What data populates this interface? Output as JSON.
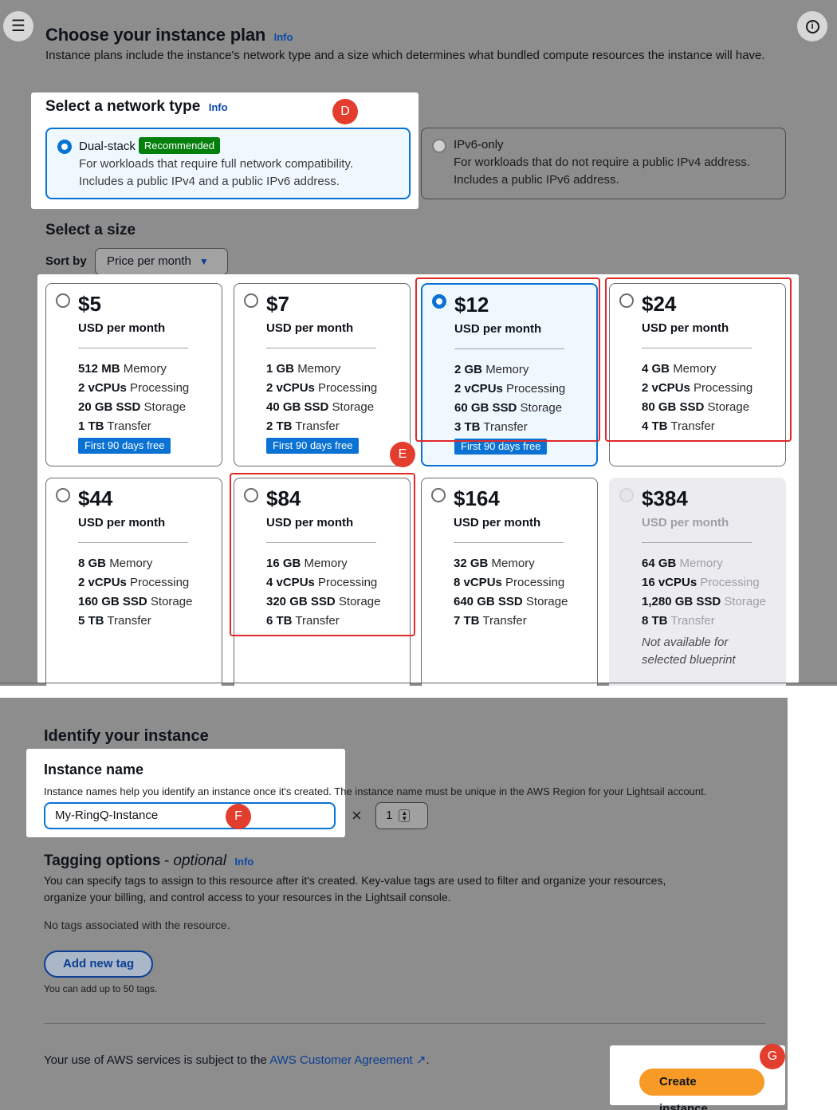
{
  "plan": {
    "title": "Choose your instance plan",
    "info": "Info",
    "description": "Instance plans include the instance's network type and a size which determines what bundled compute resources the instance will have."
  },
  "network": {
    "title": "Select a network type",
    "info": "Info",
    "options": [
      {
        "title": "Dual-stack",
        "badge": "Recommended",
        "line1": "For workloads that require full network compatibility.",
        "line2": "Includes a public IPv4 and a public IPv6 address.",
        "selected": true
      },
      {
        "title": "IPv6-only",
        "line1": "For workloads that do not require a public IPv4 address.",
        "line2": "Includes a public IPv6 address.",
        "selected": false
      }
    ]
  },
  "size": {
    "title": "Select a size",
    "sort_label": "Sort by",
    "sort_value": "Price per month",
    "per_month": "USD per month",
    "spec_labels": {
      "memory": "Memory",
      "processing": "Processing",
      "storage": "Storage",
      "transfer": "Transfer"
    },
    "free_badge": "First 90 days free",
    "not_available": [
      "Not available for",
      "selected blueprint"
    ],
    "plans": [
      {
        "price": "$5",
        "memory": "512 MB",
        "cpu": "2 vCPUs",
        "storage": "20 GB SSD",
        "transfer": "1 TB",
        "free": true,
        "selected": false
      },
      {
        "price": "$7",
        "memory": "1 GB",
        "cpu": "2 vCPUs",
        "storage": "40 GB SSD",
        "transfer": "2 TB",
        "free": true,
        "selected": false
      },
      {
        "price": "$12",
        "memory": "2 GB",
        "cpu": "2 vCPUs",
        "storage": "60 GB SSD",
        "transfer": "3 TB",
        "free": true,
        "selected": true
      },
      {
        "price": "$24",
        "memory": "4 GB",
        "cpu": "2 vCPUs",
        "storage": "80 GB SSD",
        "transfer": "4 TB",
        "free": false,
        "selected": false
      },
      {
        "price": "$44",
        "memory": "8 GB",
        "cpu": "2 vCPUs",
        "storage": "160 GB SSD",
        "transfer": "5 TB",
        "free": false,
        "selected": false
      },
      {
        "price": "$84",
        "memory": "16 GB",
        "cpu": "4 vCPUs",
        "storage": "320 GB SSD",
        "transfer": "6 TB",
        "free": false,
        "selected": false
      },
      {
        "price": "$164",
        "memory": "32 GB",
        "cpu": "8 vCPUs",
        "storage": "640 GB SSD",
        "transfer": "7 TB",
        "free": false,
        "selected": false
      },
      {
        "price": "$384",
        "memory": "64 GB",
        "cpu": "16 vCPUs",
        "storage": "1,280 GB SSD",
        "transfer": "8 TB",
        "free": false,
        "selected": false,
        "disabled": true
      }
    ]
  },
  "identify": {
    "title": "Identify your instance",
    "name_label": "Instance name",
    "name_help": "Instance names help you identify an instance once it's created. The instance name must be unique in the AWS Region for your Lightsail account.",
    "name_value": "My-RingQ-Instance",
    "multiply": "×",
    "count": "1"
  },
  "tagging": {
    "title": "Tagging options",
    "optional": "- optional",
    "info": "Info",
    "desc1": "You can specify tags to assign to this resource after it's created. Key-value tags are used to filter and organize your resources,",
    "desc2": "organize your billing, and control access to your resources in the Lightsail console.",
    "no_tags": "No tags associated with the resource.",
    "add_button": "Add new tag",
    "limit": "You can add up to 50 tags."
  },
  "footer": {
    "agreement_prefix": "Your use of AWS services is subject to the",
    "agreement_link": "AWS Customer Agreement",
    "agreement_suffix": ".",
    "create_button": "Create instance"
  },
  "markers": {
    "d": "D",
    "e": "E",
    "f": "F",
    "g": "G"
  },
  "colors": {
    "primary": "#0972d3",
    "recommended": "#037f0c",
    "create": "#f79a26",
    "marker": "#e33d2e"
  }
}
